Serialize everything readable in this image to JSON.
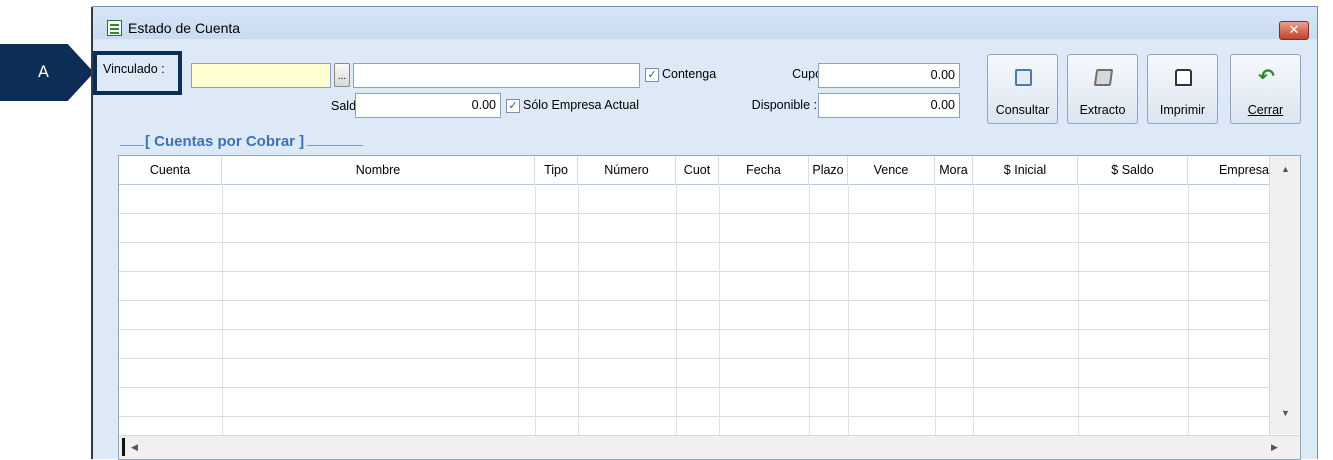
{
  "callout": {
    "label": "A"
  },
  "window": {
    "title": "Estado de Cuenta",
    "close_symbol": "✕"
  },
  "form": {
    "vinculado_label": "Vinculado :",
    "vinculado_value": "",
    "dots_label": "...",
    "nombre_value": "",
    "contenga_label": "Contenga",
    "contenga_checked": "✓",
    "saldo_label": "Saldo",
    "saldo_value": "0.00",
    "solo_empresa_label": "Sólo Empresa Actual",
    "solo_empresa_checked": "✓",
    "cupo_label": "Cupo :",
    "cupo_value": "0.00",
    "disponible_label": "Disponible :",
    "disponible_value": "0.00"
  },
  "toolbar": {
    "consultar": "Consultar",
    "extracto": "Extracto",
    "imprimir": "Imprimir",
    "cerrar": "Cerrar"
  },
  "group": {
    "title": "[ Cuentas por Cobrar ]"
  },
  "grid": {
    "columns": [
      "Cuenta",
      "Nombre",
      "Tipo",
      "Número",
      "Cuot",
      "Fecha",
      "Plazo",
      "Vence",
      "Mora",
      "$ Inicial",
      "$ Saldo",
      "Empresa"
    ],
    "rows": []
  },
  "colors": {
    "accent": "#0c2d55",
    "window_bg": "#dde9f7",
    "group_title": "#3f72b0"
  }
}
